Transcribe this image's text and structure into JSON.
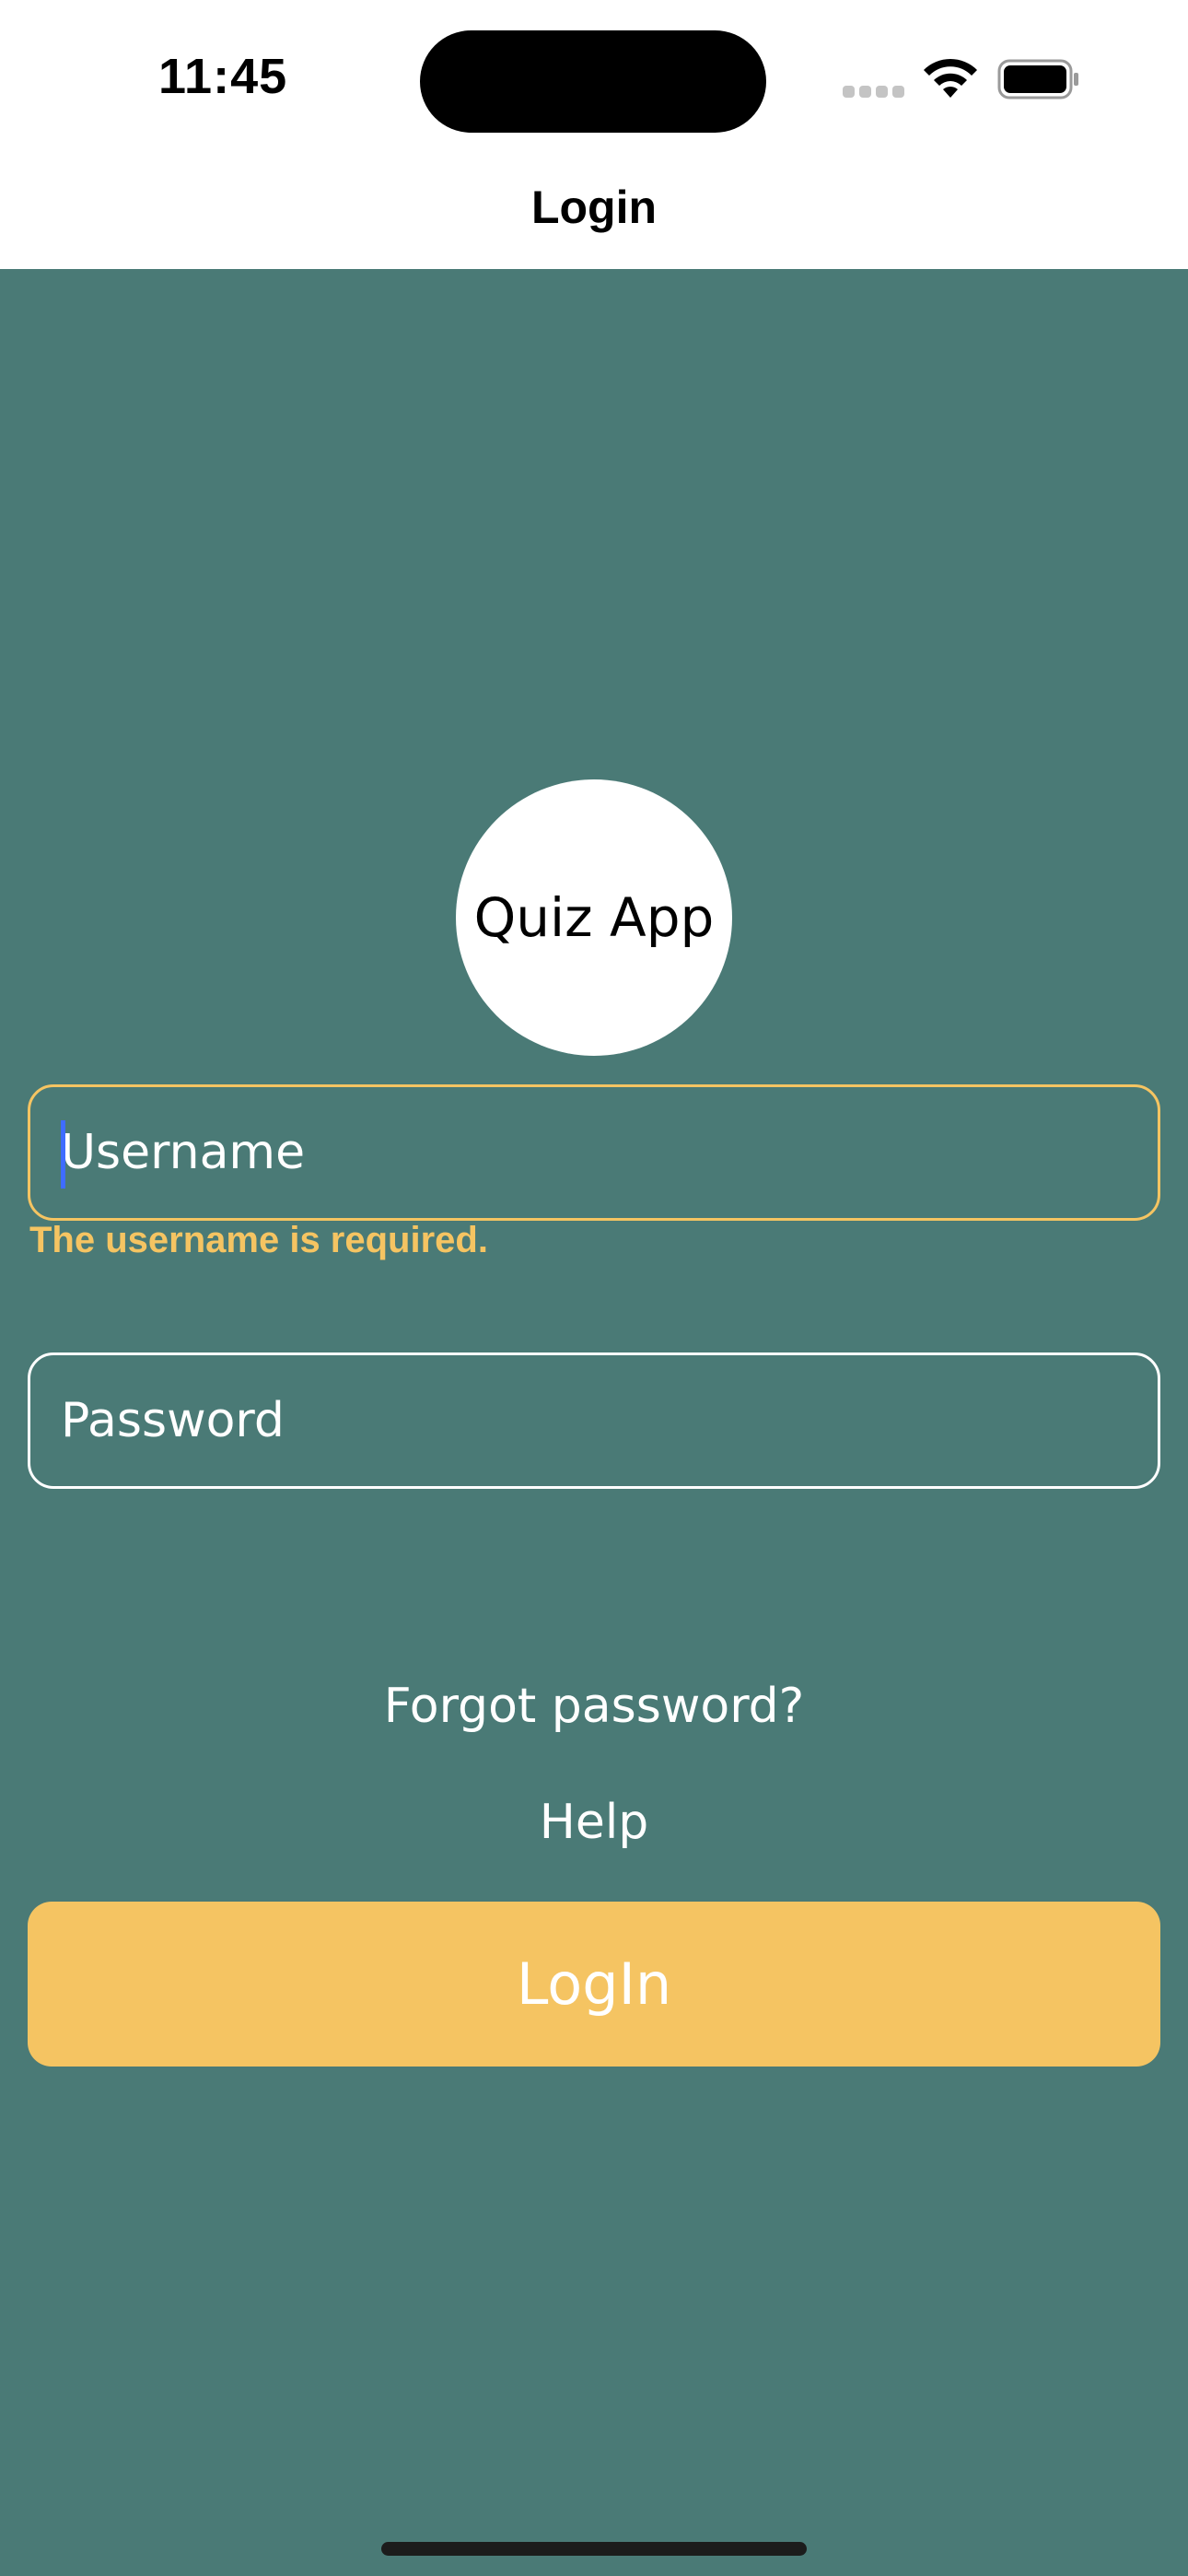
{
  "status_bar": {
    "time": "11:45",
    "signal_icon": "cellular-signal-icon",
    "wifi_icon": "wifi-icon",
    "battery_icon": "battery-icon"
  },
  "nav": {
    "title": "Login"
  },
  "logo": {
    "text": "Quiz App"
  },
  "form": {
    "username": {
      "placeholder": "Username",
      "value": "",
      "error": "The username is required."
    },
    "password": {
      "placeholder": "Password",
      "value": ""
    }
  },
  "links": {
    "forgot_password": "Forgot password?",
    "help": "Help"
  },
  "login_button": {
    "label": "LogIn"
  },
  "colors": {
    "background": "#4a7a76",
    "accent": "#f5c462",
    "header": "#ffffff",
    "caret": "#3f6cff"
  }
}
